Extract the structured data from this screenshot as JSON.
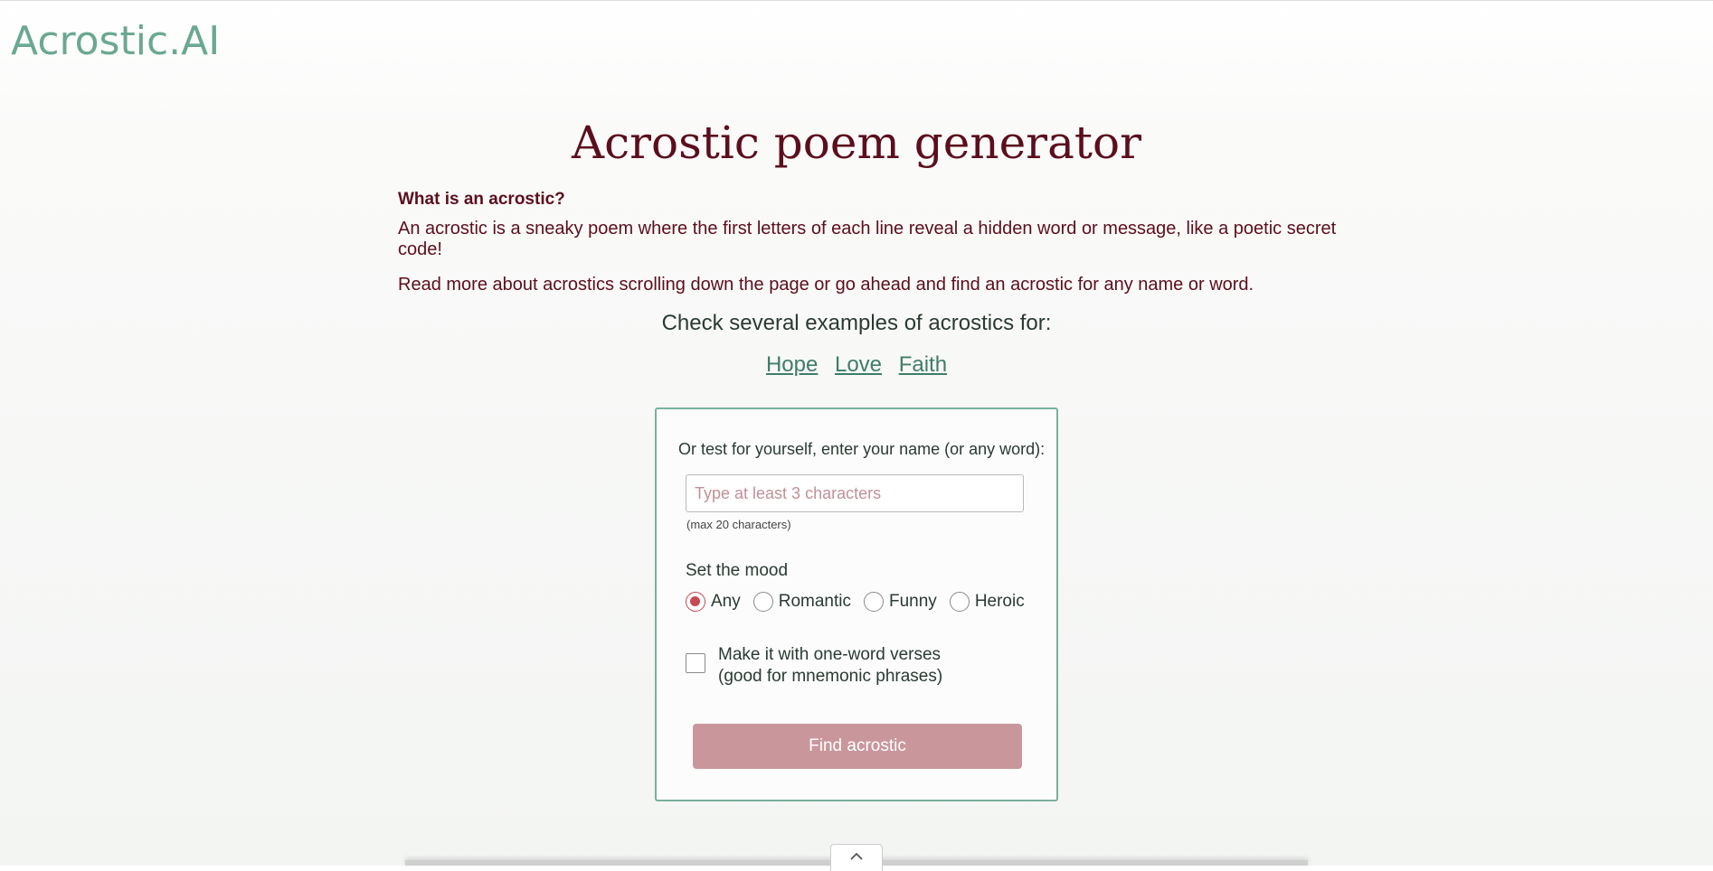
{
  "header": {
    "logo": "Acrostic.AI"
  },
  "main": {
    "title": "Acrostic poem generator",
    "question": "What is an acrostic?",
    "description": "An acrostic is a sneaky poem where the first letters of each line reveal a hidden word or message, like a poetic secret code!",
    "read_more": "Read more about acrostics scrolling down the page or go ahead and find an acrostic for any name or word.",
    "examples_label": "Check several examples of acrostics for:",
    "example_links": [
      "Hope",
      "Love",
      "Faith"
    ]
  },
  "form": {
    "lead": "Or test for yourself, enter your name (or any word):",
    "input_value": "",
    "input_placeholder": "Type at least 3 characters",
    "max_note": "(max 20 characters)",
    "mood_label": "Set the mood",
    "moods": [
      "Any",
      "Romantic",
      "Funny",
      "Heroic"
    ],
    "selected_mood": "Any",
    "checkbox_line1": "Make it with one-word verses",
    "checkbox_line2": "(good for mnemonic phrases)",
    "checkbox_checked": false,
    "submit_label": "Find acrostic"
  },
  "colors": {
    "brand": "#6aa892",
    "title": "#5c0e1d",
    "link": "#3f7d68",
    "accent": "#c44a53",
    "button": "#c9979b"
  },
  "icons": {
    "scroll_up": "chevron-up-icon"
  }
}
